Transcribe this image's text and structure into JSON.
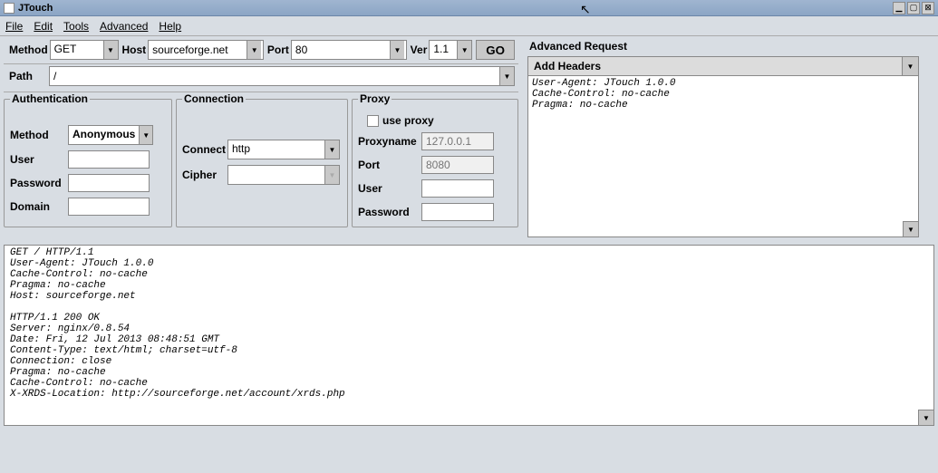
{
  "window": {
    "title": "JTouch"
  },
  "menu": {
    "file": "File",
    "edit": "Edit",
    "tools": "Tools",
    "advanced": "Advanced",
    "help": "Help"
  },
  "req": {
    "method_lbl": "Method",
    "method_val": "GET",
    "host_lbl": "Host",
    "host_val": "sourceforge.net",
    "port_lbl": "Port",
    "port_val": "80",
    "ver_lbl": "Ver",
    "ver_val": "1.1",
    "go": "GO",
    "path_lbl": "Path",
    "path_val": "/"
  },
  "auth": {
    "legend": "Authentication",
    "method_lbl": "Method",
    "method_val": "Anonymous",
    "user_lbl": "User",
    "user_val": "",
    "pass_lbl": "Password",
    "pass_val": "",
    "domain_lbl": "Domain",
    "domain_val": ""
  },
  "conn": {
    "legend": "Connection",
    "connect_lbl": "Connect",
    "connect_val": "http",
    "cipher_lbl": "Cipher",
    "cipher_val": ""
  },
  "proxy": {
    "legend": "Proxy",
    "use_lbl": "use proxy",
    "name_lbl": "Proxyname",
    "name_ph": "127.0.0.1",
    "port_lbl": "Port",
    "port_ph": "8080",
    "user_lbl": "User",
    "user_val": "",
    "pass_lbl": "Password",
    "pass_val": ""
  },
  "adv": {
    "title": "Advanced Request",
    "add_headers": "Add Headers",
    "headers_text": "User-Agent: JTouch 1.0.0\nCache-Control: no-cache\nPragma: no-cache"
  },
  "output": "GET / HTTP/1.1\nUser-Agent: JTouch 1.0.0\nCache-Control: no-cache\nPragma: no-cache\nHost: sourceforge.net\n\nHTTP/1.1 200 OK\nServer: nginx/0.8.54\nDate: Fri, 12 Jul 2013 08:48:51 GMT\nContent-Type: text/html; charset=utf-8\nConnection: close\nPragma: no-cache\nCache-Control: no-cache\nX-XRDS-Location: http://sourceforge.net/account/xrds.php"
}
